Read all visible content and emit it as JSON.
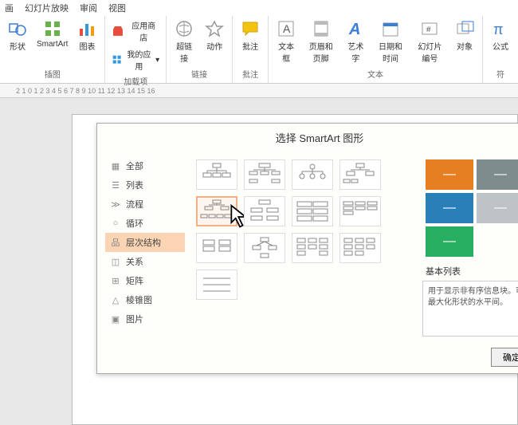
{
  "menubar": [
    "画",
    "幻灯片放映",
    "审阅",
    "视图"
  ],
  "ribbon": {
    "groups": [
      {
        "label": "插图",
        "buttons": [
          {
            "name": "shape-button",
            "label": "形状",
            "icon": "shapes"
          },
          {
            "name": "smartart-button",
            "label": "SmartArt",
            "icon": "smartart"
          },
          {
            "name": "chart-button",
            "label": "图表",
            "icon": "chart"
          }
        ]
      },
      {
        "label": "加载项",
        "buttons": [
          {
            "name": "store-button",
            "label": "应用商店",
            "icon": "store"
          },
          {
            "name": "myapps-button",
            "label": "我的应用",
            "icon": "myapps"
          }
        ]
      },
      {
        "label": "链接",
        "buttons": [
          {
            "name": "hyperlink-button",
            "label": "超链接",
            "icon": "link"
          },
          {
            "name": "action-button",
            "label": "动作",
            "icon": "action"
          }
        ]
      },
      {
        "label": "批注",
        "buttons": [
          {
            "name": "comment-button",
            "label": "批注",
            "icon": "comment"
          }
        ]
      },
      {
        "label": "文本",
        "buttons": [
          {
            "name": "textbox-button",
            "label": "文本框",
            "icon": "textbox"
          },
          {
            "name": "headerfooter-button",
            "label": "页眉和页脚",
            "icon": "headerfooter"
          },
          {
            "name": "wordart-button",
            "label": "艺术字",
            "icon": "wordart"
          },
          {
            "name": "datetime-button",
            "label": "日期和时间",
            "icon": "datetime"
          },
          {
            "name": "slidenum-button",
            "label": "幻灯片编号",
            "icon": "slidenum"
          },
          {
            "name": "object-button",
            "label": "对象",
            "icon": "object"
          }
        ]
      },
      {
        "label": "符",
        "buttons": [
          {
            "name": "equation-button",
            "label": "公式",
            "icon": "equation"
          }
        ]
      }
    ]
  },
  "ruler": "2   1   0   1   2   3   4   5   6   7   8   9   10  11  12  13  14  15  16",
  "dialog": {
    "title": "选择 SmartArt 图形",
    "categories": [
      {
        "name": "cat-all",
        "label": "全部",
        "icon": "all"
      },
      {
        "name": "cat-list",
        "label": "列表",
        "icon": "list"
      },
      {
        "name": "cat-process",
        "label": "流程",
        "icon": "process"
      },
      {
        "name": "cat-cycle",
        "label": "循环",
        "icon": "cycle"
      },
      {
        "name": "cat-hierarchy",
        "label": "层次结构",
        "icon": "hierarchy",
        "selected": true
      },
      {
        "name": "cat-relationship",
        "label": "关系",
        "icon": "relationship"
      },
      {
        "name": "cat-matrix",
        "label": "矩阵",
        "icon": "matrix"
      },
      {
        "name": "cat-pyramid",
        "label": "棱锥图",
        "icon": "pyramid"
      },
      {
        "name": "cat-picture",
        "label": "图片",
        "icon": "picture"
      }
    ],
    "preview": {
      "colors": [
        "#e67e22",
        "#7f8c8d",
        "#2980b9",
        "#bdc3c7",
        "#27ae60"
      ],
      "title": "基本列表",
      "desc": "用于显示非有序信息块。可最大化形状的水平间。"
    },
    "okButton": "确定"
  }
}
